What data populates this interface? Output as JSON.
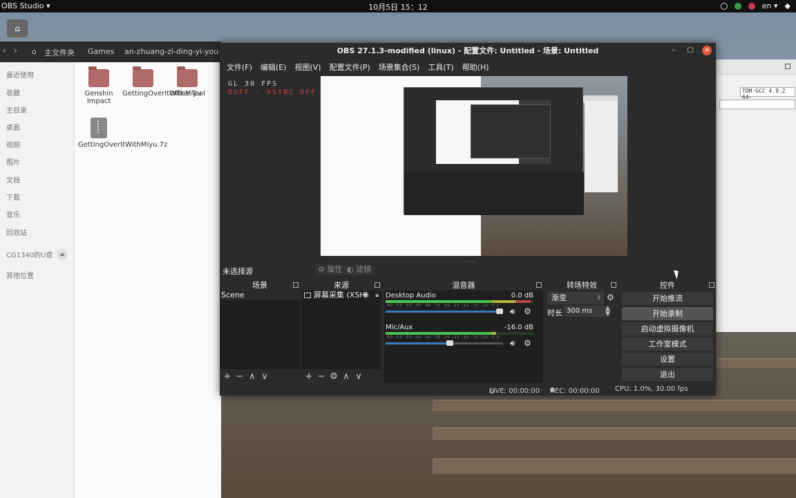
{
  "topbar": {
    "app_name": "OBS Studio ▾",
    "clock": "10月5日  15：12",
    "lang": "en ▾"
  },
  "files": {
    "nav_back": "‹",
    "nav_fwd": "›",
    "breadcrumbs": [
      "主文件夹",
      "Games",
      "an-zhuang-zi-ding-yi-you-xi"
    ],
    "sidebar": [
      "最近使用",
      "收藏",
      "主目录",
      "桌面",
      "视频",
      "图片",
      "文档",
      "下载",
      "音乐",
      "回收站",
      "CG1340的U盘",
      "其他位置"
    ],
    "items": [
      {
        "label": "Genshin Impact",
        "type": "folder"
      },
      {
        "label": "GettingOverItWithMiyu",
        "type": "folder"
      },
      {
        "label": "Office Tool",
        "type": "folder"
      },
      {
        "label": "GettingOverItWithMiyu.7z",
        "type": "zip"
      }
    ]
  },
  "bgwin": {
    "field_text": "TDM-GCC 4.9.2 64-"
  },
  "obs": {
    "title": "OBS 27.1.3-modified (linux) - 配置文件: Untitled - 场景: Untitled",
    "menus": [
      "文件(F)",
      "编辑(E)",
      "视图(V)",
      "配置文件(P)",
      "场景集合(S)",
      "工具(T)",
      "帮助(H)"
    ],
    "overlay_fps": "GL 30 FPS",
    "overlay_vsync": "BUFF · VSYNC OFF",
    "no_source": "未选择源",
    "properties_btn": "⚙ 属性",
    "filters_btn": "◐ 滤镜",
    "docks": {
      "scenes": "场景",
      "sources": "来源",
      "mixer": "混音器",
      "transitions": "转场特效",
      "controls": "控件"
    },
    "scene_list": [
      "Scene"
    ],
    "source_list": [
      "屏幕采集 (XSHI"
    ],
    "mixer": [
      {
        "name": "Desktop Audio",
        "db": "0.0 dB",
        "level": 0.98,
        "volume": 1.0
      },
      {
        "name": "Mic/Aux",
        "db": "-16.0 dB",
        "level": 0.75,
        "volume": 0.55
      }
    ],
    "meter_ticks": "-60 -55 -50 -45 -40 -35 -30 -25 -20 -15 -10 -5 0",
    "transition": {
      "selected": "渐变",
      "duration_label": "时长",
      "duration": "300 ms"
    },
    "controls": [
      "开始推流",
      "开始录制",
      "启动虚拟摄像机",
      "工作室模式",
      "设置",
      "退出"
    ],
    "status": {
      "live": "LIVE: 00:00:00",
      "rec": "REC: 00:00:00",
      "cpu": "CPU: 1.0%, 30.00 fps"
    }
  }
}
